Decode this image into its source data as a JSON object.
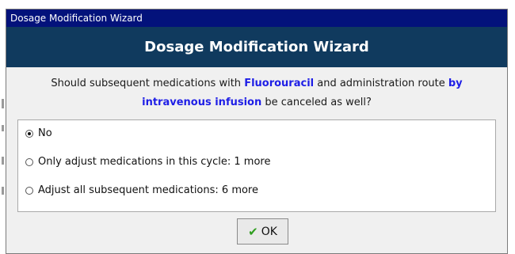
{
  "window": {
    "title": "Dosage Modification Wizard"
  },
  "banner": {
    "title": "Dosage Modification Wizard"
  },
  "question": {
    "part1": "Should subsequent  medications with ",
    "drug": "Fluorouracil",
    "part2": " and administration route ",
    "route": "by intravenous infusion",
    "part3": " be canceled as well?"
  },
  "options": [
    {
      "label": "No",
      "selected": true
    },
    {
      "label": "Only adjust medications in this cycle: 1 more",
      "selected": false
    },
    {
      "label": "Adjust all subsequent medications: 6 more",
      "selected": false
    }
  ],
  "ok_button": {
    "label": "OK",
    "icon": "checkmark-icon"
  },
  "colors": {
    "titlebar": "#03127b",
    "banner": "#103a5e",
    "highlight": "#1e1ee6",
    "check": "#2f9e1f"
  }
}
